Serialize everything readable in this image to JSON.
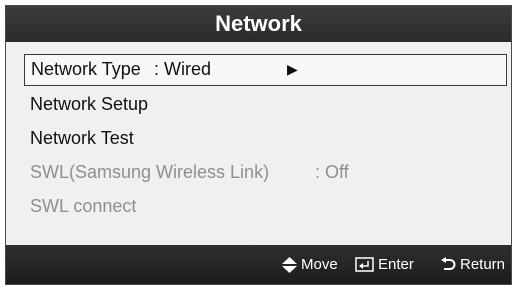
{
  "title": "Network",
  "menu": {
    "items": [
      {
        "label": "Network Type",
        "value": ": Wired",
        "arrow": "▶",
        "selected": true,
        "enabled": true
      },
      {
        "label": "Network Setup",
        "value": "",
        "selected": false,
        "enabled": true
      },
      {
        "label": "Network Test",
        "value": "",
        "selected": false,
        "enabled": true
      },
      {
        "label": "SWL(Samsung Wireless Link)",
        "value": ": Off",
        "selected": false,
        "enabled": false
      },
      {
        "label": "SWL connect",
        "value": "",
        "selected": false,
        "enabled": false
      }
    ]
  },
  "footer": {
    "move_label": "Move",
    "move_icon": "up-down-diamond-icon",
    "enter_label": "Enter",
    "enter_icon": "enter-icon",
    "return_label": "Return",
    "return_icon": "return-arrow-icon"
  },
  "colors": {
    "bar": "#2a2a2a",
    "panel": "#f0f0f0",
    "text": "#111111",
    "disabled_text": "#8f8f8f"
  }
}
